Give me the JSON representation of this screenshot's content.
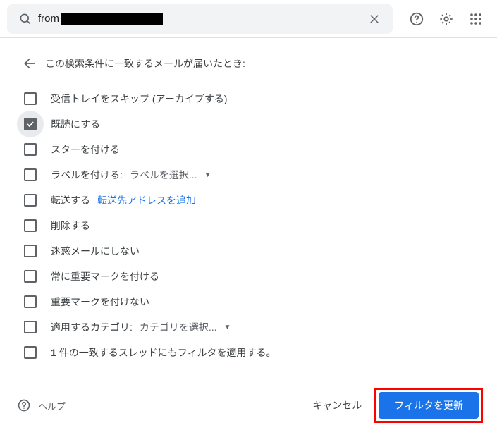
{
  "search": {
    "prefix": "from",
    "redacted": true
  },
  "heading": "この検索条件に一致するメールが届いたとき:",
  "options": {
    "skip_inbox": "受信トレイをスキップ (アーカイブする)",
    "mark_read": "既読にする",
    "star": "スターを付ける",
    "label_prefix": "ラベルを付ける:",
    "label_dropdown": "ラベルを選択...",
    "forward_prefix": "転送する",
    "forward_link": "転送先アドレスを追加",
    "delete": "削除する",
    "not_spam": "迷惑メールにしない",
    "always_important": "常に重要マークを付ける",
    "never_important": "重要マークを付けない",
    "category_prefix": "適用するカテゴリ:",
    "category_dropdown": "カテゴリを選択...",
    "apply_to_matching": "1 件の一致するスレッドにもフィルタを適用する。"
  },
  "footer": {
    "help": "ヘルプ",
    "cancel": "キャンセル",
    "submit": "フィルタを更新"
  },
  "state": {
    "checked": [
      "mark_read"
    ]
  }
}
